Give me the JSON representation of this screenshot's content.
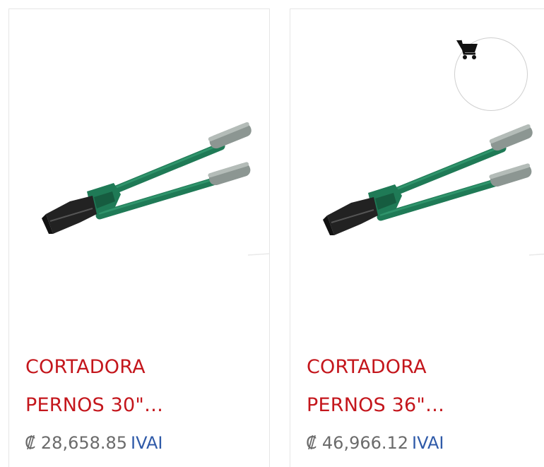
{
  "products": [
    {
      "title_line1": "CORTADORA",
      "title_line2": "PERNOS 30\"…",
      "price": "₡ 28,658.85",
      "tax_label": "IVAI",
      "image_icon": "bolt-cutter-image"
    },
    {
      "title_line1": "CORTADORA",
      "title_line2": "PERNOS 36\"…",
      "price": "₡ 46,966.12",
      "tax_label": "IVAI",
      "image_icon": "bolt-cutter-image",
      "cart_icon": "cart-icon"
    }
  ],
  "colors": {
    "title": "#c4161c",
    "price": "#6b6b6b",
    "tax": "#2f5aa8",
    "handle_green": "#1f7a56",
    "jaw_black": "#222222",
    "grip_gray": "#8c9692"
  }
}
